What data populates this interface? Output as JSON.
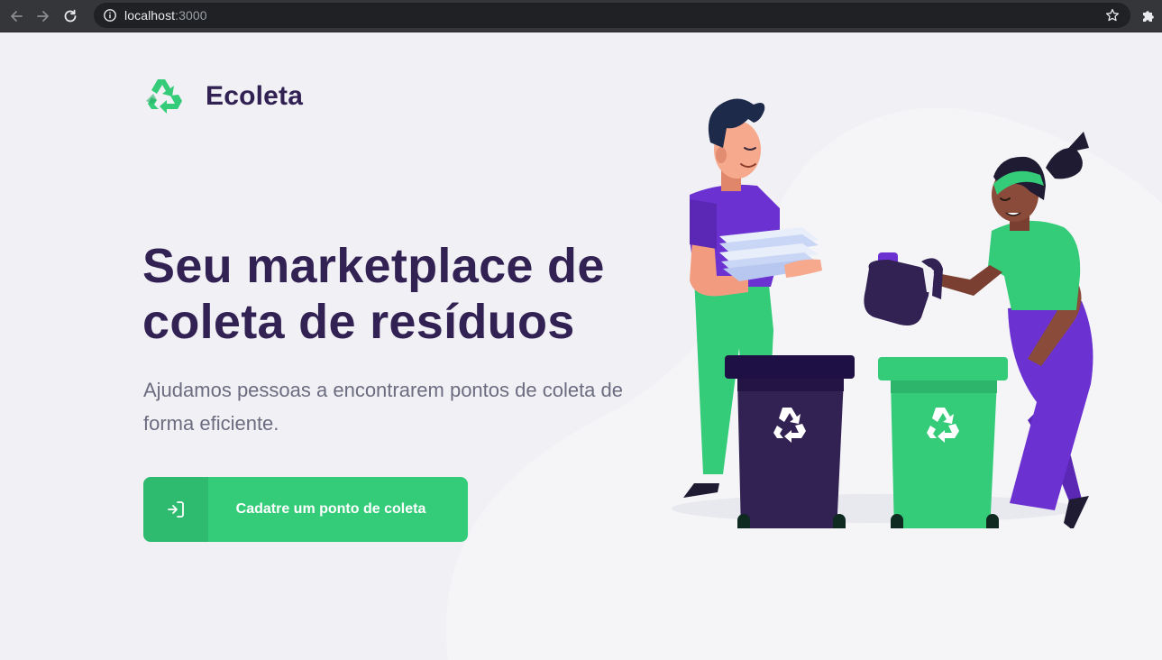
{
  "browser": {
    "url_host": "localhost",
    "url_port": ":3000",
    "icons": {
      "back": "arrow-left-icon",
      "forward": "arrow-right-icon",
      "reload": "reload-icon",
      "info": "info-icon",
      "bookmark": "star-icon",
      "extensions": "puzzle-icon"
    }
  },
  "header": {
    "logo_name": "Ecoleta",
    "logo_icon": "recycle-icon"
  },
  "hero": {
    "title": "Seu marketplace de coleta de resíduos",
    "subtitle": "Ajudamos pessoas a encontrarem pontos de coleta de forma eficiente."
  },
  "cta": {
    "label": "Cadatre um ponto de coleta",
    "icon": "log-in-icon"
  },
  "colors": {
    "primary": "#34CB79",
    "title": "#322153",
    "text": "#6C6C80",
    "background": "#F0F0F5",
    "chrome": "#35363A"
  }
}
